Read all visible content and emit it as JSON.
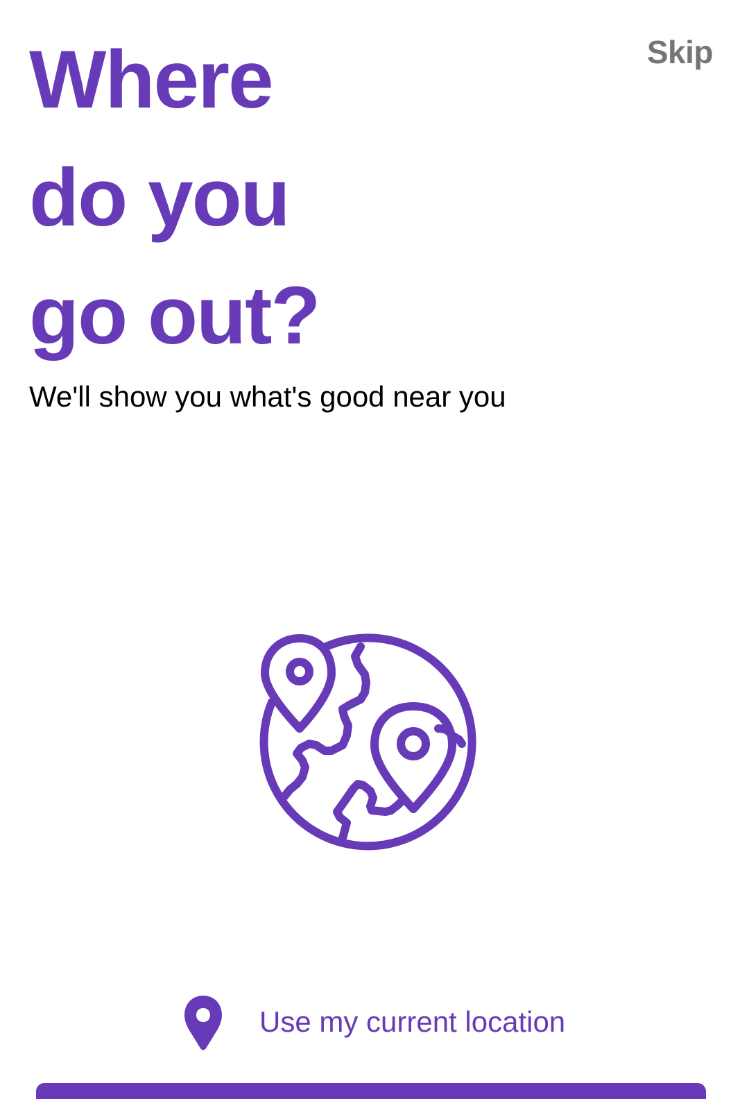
{
  "header": {
    "skip_label": "Skip"
  },
  "title": {
    "line1": "Where",
    "line2": "do you",
    "line3": "go out?"
  },
  "subtitle": "We'll show you what's good near you",
  "illustration": {
    "icon": "globe-with-location-pins-icon"
  },
  "location_button": {
    "icon": "location-pin-icon",
    "label": "Use my current location"
  },
  "colors": {
    "accent": "#673AB7",
    "skip_text": "#757575",
    "body_text": "#000000",
    "background": "#ffffff"
  }
}
